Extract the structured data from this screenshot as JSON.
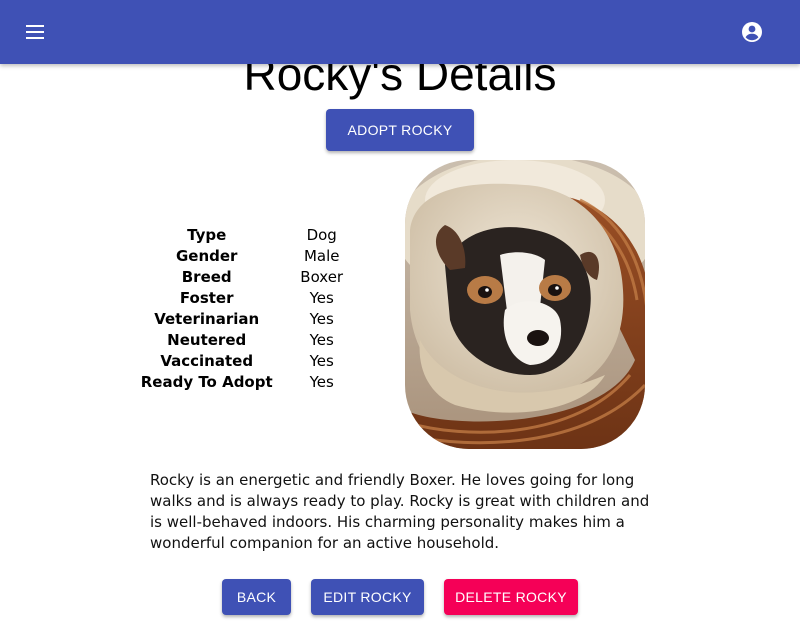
{
  "appbar": {
    "color": "#3f51b5",
    "menu_icon": "hamburger-menu-icon",
    "account_icon": "account-circle-icon"
  },
  "page": {
    "title": "Rocky's Details"
  },
  "actions": {
    "adopt_label": "ADOPT ROCKY",
    "back_label": "BACK",
    "edit_label": "EDIT ROCKY",
    "delete_label": "DELETE ROCKY",
    "primary_color": "#3f51b5",
    "danger_color": "#f50057"
  },
  "details": [
    {
      "label": "Type",
      "value": "Dog"
    },
    {
      "label": "Gender",
      "value": "Male"
    },
    {
      "label": "Breed",
      "value": "Boxer"
    },
    {
      "label": "Foster",
      "value": "Yes"
    },
    {
      "label": "Veterinarian",
      "value": "Yes"
    },
    {
      "label": "Neutered",
      "value": "Yes"
    },
    {
      "label": "Vaccinated",
      "value": "Yes"
    },
    {
      "label": "Ready To Adopt",
      "value": "Yes"
    }
  ],
  "photo": {
    "subject": "puppy in wicker basket"
  },
  "description": "Rocky is an energetic and friendly Boxer. He loves going for long walks and is always ready to play. Rocky is great with children and is well-behaved indoors. His charming personality makes him a wonderful companion for an active household."
}
